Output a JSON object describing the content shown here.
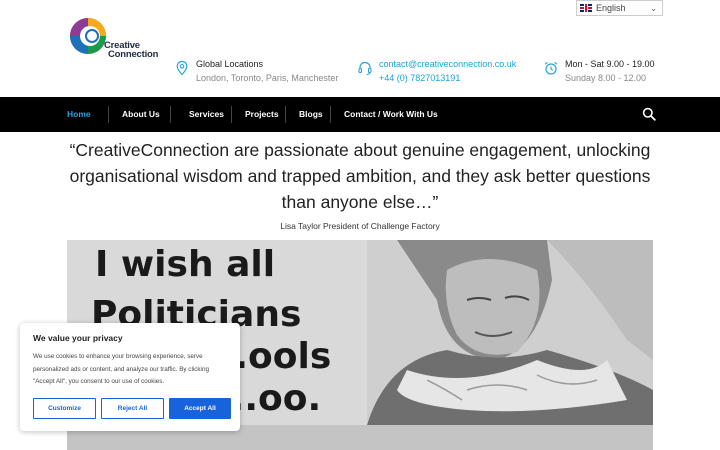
{
  "language": {
    "selected": "English",
    "flag_icon": "uk-flag-icon"
  },
  "logo": {
    "line1": "Creative",
    "line2": "Connection"
  },
  "header": {
    "locations": {
      "title": "Global Locations",
      "detail": "London, Toronto, Paris, Manchester",
      "icon": "location-pin-icon"
    },
    "contact": {
      "email": "contact@creativeconnection.co.uk",
      "phone": "+44 (0) 7827013191",
      "icon": "headset-icon"
    },
    "hours": {
      "days": "Mon - Sat 9.00 - 19.00",
      "sunday": "Sunday 8.00 - 12.00",
      "icon": "alarm-clock-icon"
    }
  },
  "nav": {
    "items": [
      "Home",
      "About Us",
      "Services",
      "Projects",
      "Blogs",
      "Contact / Work With Us"
    ],
    "active": "Home",
    "search_icon": "search-icon"
  },
  "testimonial": {
    "quote": "“CreativeConnection are passionate about genuine engagement, unlocking organisational wisdom and trapped ambition, and they ask better questions than anyone else…”",
    "author": "Lisa Taylor President of Challenge Factory"
  },
  "hero_image": {
    "text_lines": [
      "I wish all",
      "Politicians",
      "...ools",
      "...oo."
    ]
  },
  "cookie": {
    "title": "We value your privacy",
    "body": "We use cookies to enhance your browsing experience, serve personalized ads or content, and analyze our traffic. By clicking \"Accept All\", you consent to our use of cookies.",
    "customize": "Customize",
    "reject": "Reject All",
    "accept": "Accept All"
  },
  "colors": {
    "accent": "#29a3dd",
    "nav_bg": "#000000",
    "cookie_blue": "#1863dc"
  }
}
